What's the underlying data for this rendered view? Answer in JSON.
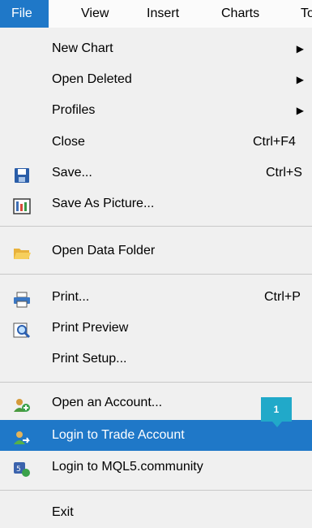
{
  "menubar": {
    "items": [
      "File",
      "View",
      "Insert",
      "Charts",
      "To"
    ]
  },
  "file_menu": {
    "items": [
      {
        "label": "New Chart",
        "submenu": true
      },
      {
        "label": "Open Deleted",
        "submenu": true
      },
      {
        "label": "Profiles",
        "submenu": true
      },
      {
        "label": "Close",
        "shortcut": "Ctrl+F4"
      },
      {
        "label": "Save...",
        "shortcut": "Ctrl+S",
        "icon": "save-icon"
      },
      {
        "label": "Save As Picture...",
        "icon": "picture-icon"
      },
      {
        "label": "Open Data Folder",
        "icon": "folder-icon"
      },
      {
        "label": "Print...",
        "shortcut": "Ctrl+P",
        "icon": "printer-icon"
      },
      {
        "label": "Print Preview",
        "icon": "print-preview-icon"
      },
      {
        "label": "Print Setup..."
      },
      {
        "label": "Open an Account...",
        "icon": "open-account-icon"
      },
      {
        "label": "Login to Trade Account",
        "icon": "login-trade-icon",
        "highlighted": true
      },
      {
        "label": "Login to MQL5.community",
        "icon": "mql5-icon"
      },
      {
        "label": "Exit"
      }
    ]
  },
  "badge": {
    "text": "1"
  },
  "colors": {
    "highlight": "#1f78c8",
    "menu_bg": "#f0f0f0",
    "badge": "#21a9c9"
  }
}
